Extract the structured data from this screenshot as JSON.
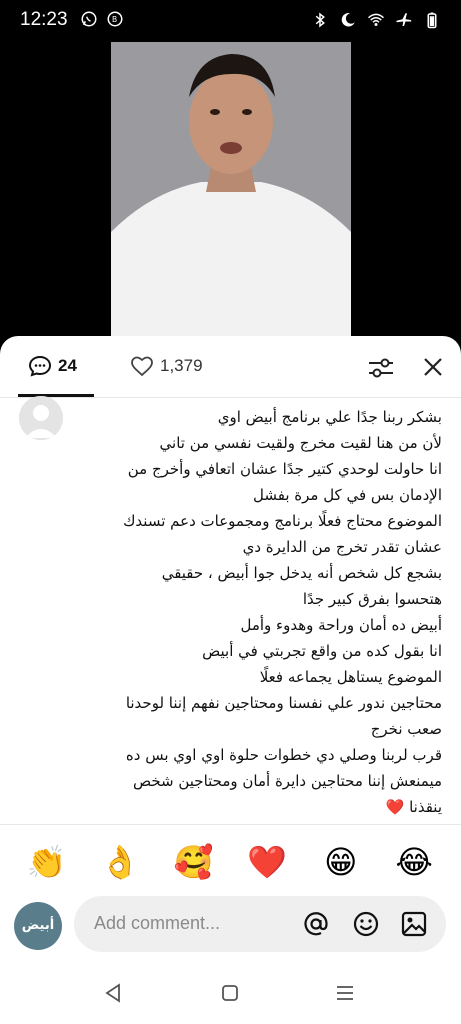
{
  "status_bar": {
    "time": "12:23",
    "left_icons": [
      "whatsapp-icon",
      "whatsapp-business-icon"
    ],
    "right_icons": [
      "bluetooth-icon",
      "do-not-disturb-icon",
      "wifi-icon",
      "airplane-icon",
      "battery-icon"
    ]
  },
  "comments_header": {
    "comment_count": "24",
    "like_count": "1,379"
  },
  "comment": {
    "lines": [
      "بشكر ربنا جدًا علي برنامج أبيض اوي",
      "لأن من هنا لقيت مخرج ولقيت نفسي من تاني",
      "انا حاولت لوحدي كتير جدًا عشان اتعافي وأخرج من",
      "الإدمان بس في كل مرة بفشل",
      "الموضوع محتاج فعلًا برنامج ومجموعات دعم تسندك",
      "عشان تقدر تخرج من الدايرة دي",
      "بشجع كل شخص أنه يدخل جوا أبيض ، حقيقي",
      "هتحسوا بفرق كبير جدًا",
      "أبيض ده أمان وراحة وهدوء وأمل",
      "انا بقول كده من واقع تجربتي في أبيض",
      "الموضوع يستاهل يجماعه فعلًا",
      "محتاجين ندور علي نفسنا ومحتاجين نفهم إننا لوحدنا",
      "صعب نخرج",
      "قرب لربنا وصلي دي خطوات حلوة اوي اوي بس ده",
      "ميمنعش إننا محتاجين دايرة أمان ومحتاجين شخص",
      "ينقذنا ❤️"
    ]
  },
  "reactions": [
    "👏",
    "👌",
    "🥰",
    "❤️",
    "😁",
    "😂"
  ],
  "composer": {
    "avatar_text": "أبيض",
    "placeholder": "Add comment...",
    "icons": [
      "mention-icon",
      "emoji-icon",
      "image-icon"
    ]
  },
  "nav": [
    "back-icon",
    "home-icon",
    "recents-icon"
  ],
  "colors": {
    "heart_red": "#d31818",
    "avatar_teal": "#5a7d8c",
    "input_bg": "#efefef"
  }
}
